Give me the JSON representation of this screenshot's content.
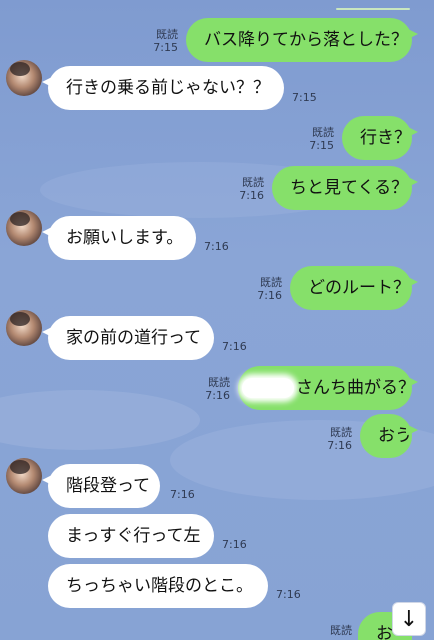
{
  "chat": {
    "read_label": "既読",
    "messages": [
      {
        "dir": "out",
        "text": "バス降りてから落とした？",
        "time": "7:15",
        "read": "既読"
      },
      {
        "dir": "in",
        "text": "行きの乗る前じゃない？？",
        "time": "7:15"
      },
      {
        "dir": "out",
        "text": "行き？",
        "time": "7:15",
        "read": "既読"
      },
      {
        "dir": "out",
        "text": "ちと見てくる？",
        "time": "7:16",
        "read": "既読"
      },
      {
        "dir": "in",
        "text": "お願いします。",
        "time": "7:16"
      },
      {
        "dir": "out",
        "text": "どのルート？",
        "time": "7:16",
        "read": "既読"
      },
      {
        "dir": "in",
        "text": "家の前の道行って",
        "time": "7:16"
      },
      {
        "dir": "out",
        "text": "さんち曲がる？",
        "time": "7:16",
        "read": "既読"
      },
      {
        "dir": "out",
        "text": "おう",
        "time": "7:16",
        "read": "既読"
      },
      {
        "dir": "in",
        "text": "階段登って",
        "time": "7:16"
      },
      {
        "dir": "in",
        "text": "まっすぐ行って左",
        "time": "7:16"
      },
      {
        "dir": "in",
        "text": "ちっちゃい階段のとこ。",
        "time": "7:16"
      },
      {
        "dir": "out",
        "text": "お",
        "time": "",
        "read": "既読"
      }
    ]
  },
  "scroll_button": {
    "icon": "arrow-down-icon",
    "glyph": "↓"
  },
  "colors": {
    "outgoing": "#86e06a",
    "incoming": "#ffffff",
    "background": "#87a3d4"
  }
}
